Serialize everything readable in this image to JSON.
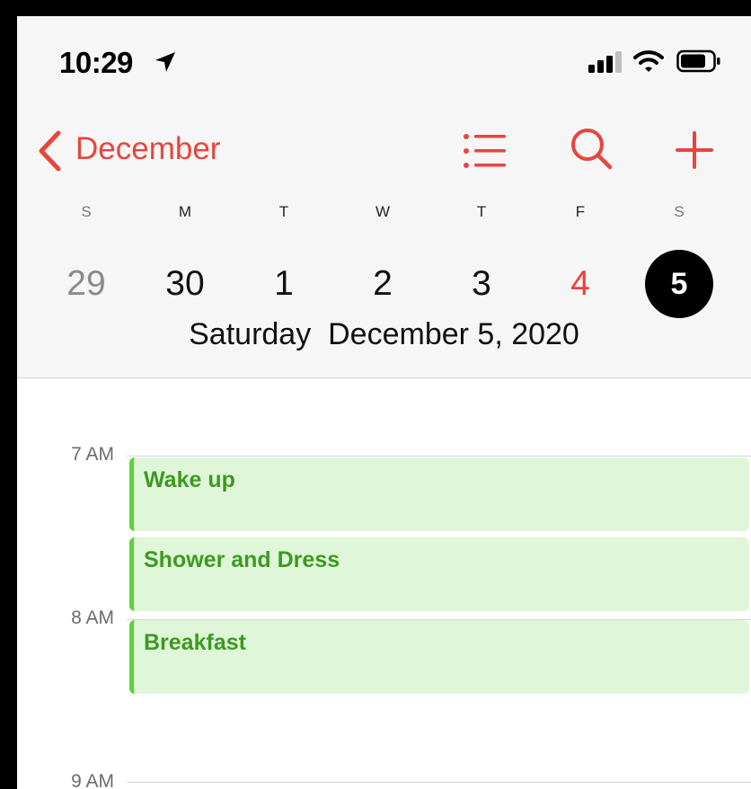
{
  "status_bar": {
    "time": "10:29"
  },
  "nav": {
    "back_label": "December"
  },
  "week": {
    "days": [
      {
        "dow": "S",
        "date": "29",
        "state": "other-month"
      },
      {
        "dow": "M",
        "date": "30",
        "state": "other-month"
      },
      {
        "dow": "T",
        "date": "1",
        "state": "normal"
      },
      {
        "dow": "W",
        "date": "2",
        "state": "normal"
      },
      {
        "dow": "T",
        "date": "3",
        "state": "normal"
      },
      {
        "dow": "F",
        "date": "4",
        "state": "today"
      },
      {
        "dow": "S",
        "date": "5",
        "state": "selected"
      }
    ],
    "selected_weekday": "Saturday",
    "selected_date": "December 5, 2020"
  },
  "day_view": {
    "hours": [
      "7 AM",
      "8 AM",
      "9 AM"
    ],
    "events": [
      {
        "title": "Wake up"
      },
      {
        "title": "Shower and Dress"
      },
      {
        "title": "Breakfast"
      }
    ]
  },
  "colors": {
    "accent": "#e8453c",
    "event_fill": "#dff7d8",
    "event_bar": "#5bd436",
    "event_text": "#3d9a21"
  }
}
